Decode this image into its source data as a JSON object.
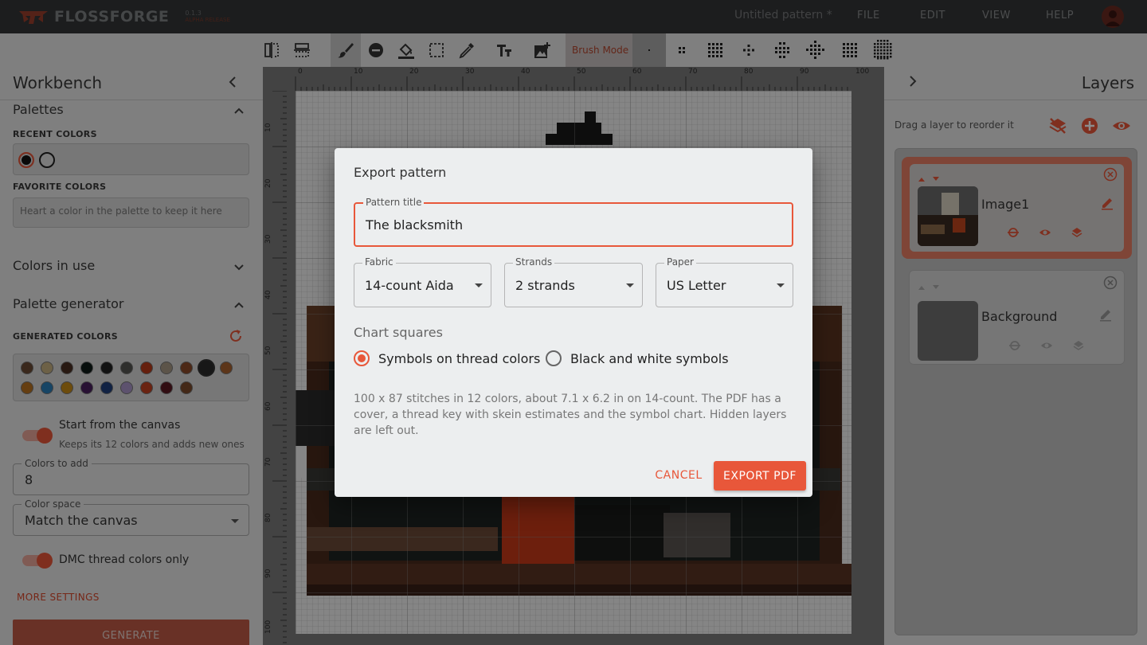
{
  "app": {
    "name": "FLOSSFORGE",
    "version": "0.1.3",
    "subtitle": "ALPHA RELEASE",
    "doc_title": "Untitled pattern *",
    "menu": [
      "FILE",
      "EDIT",
      "VIEW",
      "HELP"
    ],
    "brand_color": "#e8573a"
  },
  "toolbar": {
    "brush_mode_label": "Brush Mode",
    "tools": [
      "mirror-vertical-icon",
      "mirror-horizontal-icon",
      "brush-icon",
      "eraser-icon",
      "fill-bucket-icon",
      "select-rect-icon",
      "eyedropper-icon",
      "text-icon",
      "add-image-icon"
    ],
    "brush_sizes": [
      "brush-size-1",
      "brush-size-2",
      "brush-size-3",
      "brush-size-4",
      "brush-size-5",
      "brush-size-6",
      "brush-size-7",
      "brush-size-8"
    ]
  },
  "workbench": {
    "title": "Workbench",
    "palettes_title": "Palettes",
    "recent_colors_label": "RECENT COLORS",
    "recent_colors": [
      "#111111",
      "#e0e0e0"
    ],
    "favorite_colors_label": "FAVORITE COLORS",
    "favorite_hint": "Heart a color in the palette to keep it here",
    "colors_in_use_title": "Colors in use",
    "palette_generator_title": "Palette generator",
    "generated_colors_label": "GENERATED COLORS",
    "generated_colors": [
      "#6b4a33",
      "#c7b182",
      "#4a2e22",
      "#0d1a17",
      "#222222",
      "#555550",
      "#b83a18",
      "#a89a86",
      "#8a4a28",
      "#2b2b2b",
      "#a8622e",
      "#b8711f",
      "#2a7fb8",
      "#c78a17",
      "#4a1f5e",
      "#1f3f7a",
      "#a995c8",
      "#c24020",
      "#5a1822",
      "#7a4a2a"
    ],
    "start_from_canvas_label": "Start from the canvas",
    "start_from_canvas_sub": "Keeps its 12 colors and adds new ones",
    "colors_to_add_label": "Colors to add",
    "colors_to_add_value": "8",
    "color_space_label": "Color space",
    "color_space_value": "Match the canvas",
    "dmc_only_label": "DMC thread colors only",
    "more_settings": "MORE SETTINGS",
    "generate_label": "GENERATE"
  },
  "canvas": {
    "top_ruler": [
      "0",
      "10",
      "20",
      "30",
      "40",
      "50",
      "60",
      "70",
      "80",
      "90",
      "100"
    ],
    "left_ruler": [
      "10",
      "20",
      "30",
      "40",
      "50",
      "60",
      "70",
      "80",
      "90",
      "100"
    ]
  },
  "layers": {
    "title": "Layers",
    "drag_hint": "Drag a layer to reorder it",
    "items": [
      {
        "name": "Image1",
        "selected": true
      },
      {
        "name": "Background",
        "selected": false
      }
    ]
  },
  "dialog": {
    "title": "Export pattern",
    "pattern_title_label": "Pattern title",
    "pattern_title_value": "The blacksmith",
    "fabric_label": "Fabric",
    "fabric_value": "14-count Aida",
    "strands_label": "Strands",
    "strands_value": "2 strands",
    "paper_label": "Paper",
    "paper_value": "US Letter",
    "chart_squares_label": "Chart squares",
    "option_color": "Symbols on thread colors",
    "option_bw": "Black and white symbols",
    "selected_option": "Symbols on thread colors",
    "description": "100 x 87 stitches in 12 colors, about 7.1 x 6.2 in on 14-count. The PDF has a cover, a thread key with skein estimates and the symbol chart. Hidden layers are left out.",
    "cancel_label": "CANCEL",
    "export_label": "EXPORT PDF"
  }
}
